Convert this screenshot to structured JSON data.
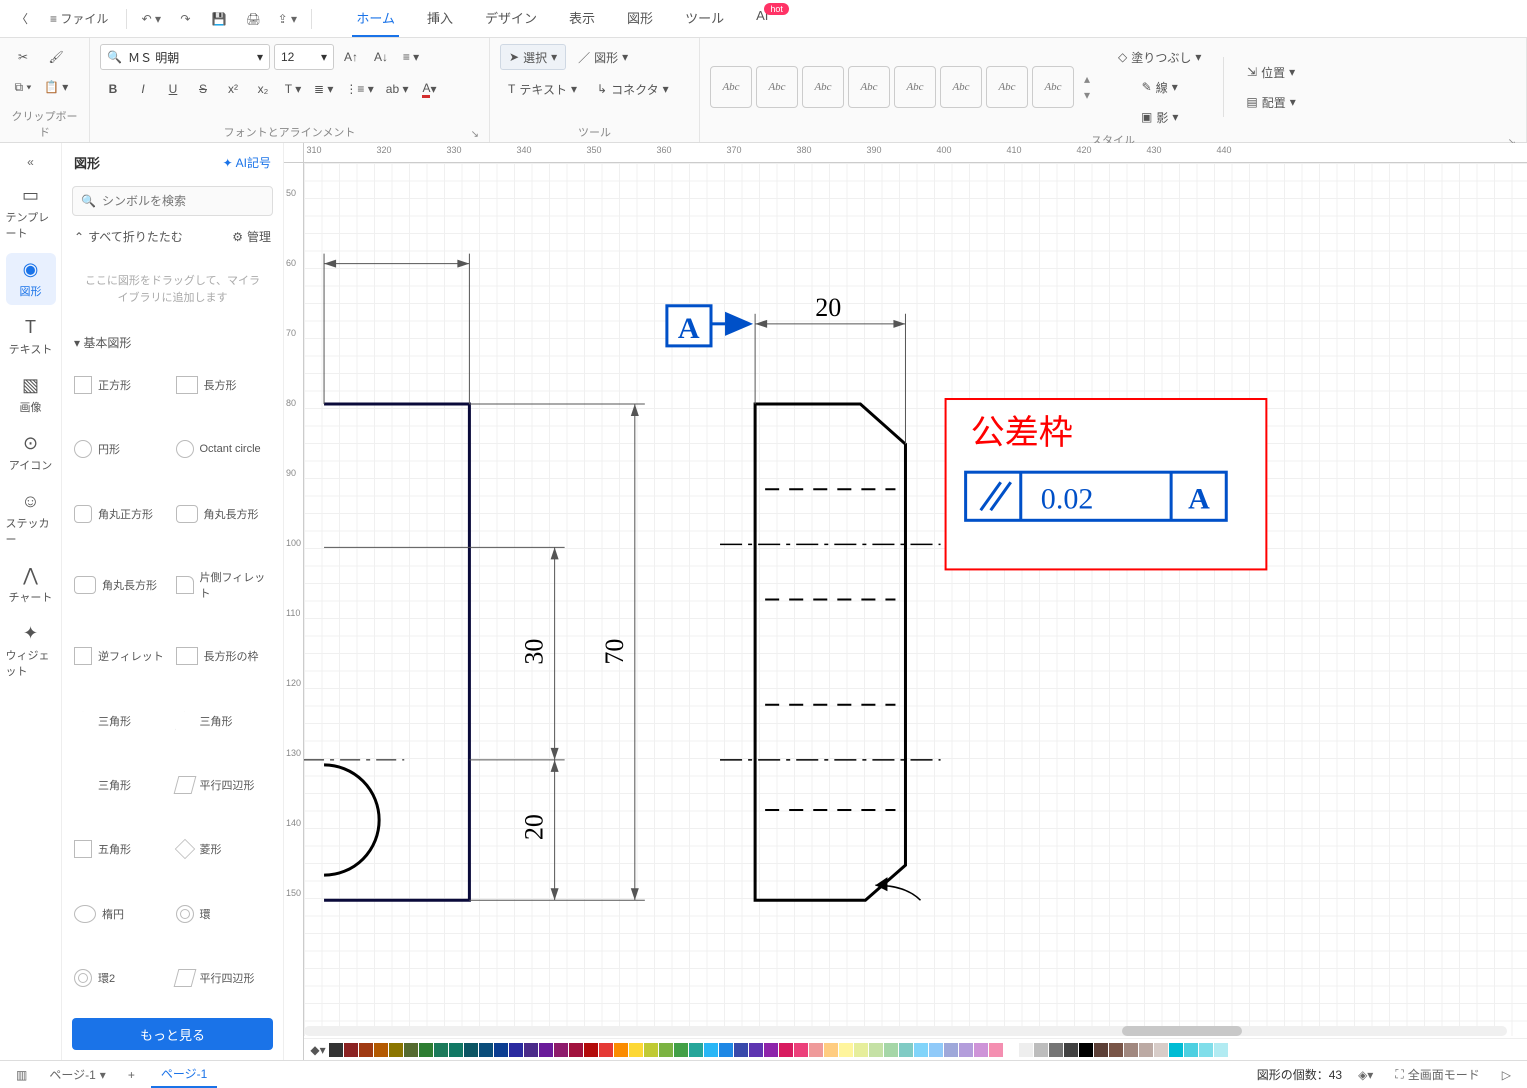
{
  "menubar": {
    "file": "ファイル",
    "tabs": [
      "ホーム",
      "挿入",
      "デザイン",
      "表示",
      "図形",
      "ツール",
      "AI"
    ],
    "active_tab": 0,
    "ai_badge": "hot"
  },
  "ribbon": {
    "clipboard_label": "クリップボード",
    "font_label": "フォントとアラインメント",
    "tool_label": "ツール",
    "style_label": "スタイル",
    "font_name": "ＭＳ 明朝",
    "font_size": "12",
    "select": "選択",
    "shape_menu": "図形",
    "text": "テキスト",
    "connector": "コネクタ",
    "style_item": "Abc",
    "fill": "塗りつぶし",
    "line": "線",
    "shadow": "影",
    "position": "位置",
    "align": "配置"
  },
  "leftrail": {
    "items": [
      {
        "label": "テンプレート",
        "icon": "▭"
      },
      {
        "label": "図形",
        "icon": "◉"
      },
      {
        "label": "テキスト",
        "icon": "T"
      },
      {
        "label": "画像",
        "icon": "▧"
      },
      {
        "label": "アイコン",
        "icon": "⊙"
      },
      {
        "label": "ステッカー",
        "icon": "☺"
      },
      {
        "label": "チャート",
        "icon": "⋀"
      },
      {
        "label": "ウィジェット",
        "icon": "✦"
      }
    ],
    "active": 1
  },
  "shapes_panel": {
    "title": "図形",
    "ai_link": "AI記号",
    "search_placeholder": "シンボルを検索",
    "collapse_all": "すべて折りたたむ",
    "manage": "管理",
    "drop_hint": "ここに図形をドラッグして、マイライブラリに追加します",
    "section": "基本図形",
    "shapes": [
      "正方形",
      "長方形",
      "円形",
      "Octant circle",
      "角丸正方形",
      "角丸長方形",
      "角丸長方形",
      "片側フィレット",
      "逆フィレット",
      "長方形の枠",
      "三角形",
      "三角形",
      "三角形",
      "平行四辺形",
      "五角形",
      "菱形",
      "楕円",
      "環",
      "環2",
      "平行四辺形"
    ],
    "more": "もっと見る"
  },
  "ruler_h_start": 310,
  "ruler_h_step": 10,
  "ruler_h_count": 94,
  "ruler_v_start": 50,
  "ruler_v_step": 10,
  "ruler_v_count": 11,
  "drawing": {
    "datum_label": "A",
    "dim_20": "20",
    "dim_70": "70",
    "dim_30": "30",
    "dim_20b": "20",
    "callout_title": "公差枠",
    "tol_value": "0.02",
    "tol_datum": "A"
  },
  "colors": [
    "#333333",
    "#8b2222",
    "#a03a12",
    "#b35900",
    "#8b7500",
    "#556b2f",
    "#2e7d32",
    "#1b7a5a",
    "#117864",
    "#0b5563",
    "#0a4d7a",
    "#0b3d91",
    "#2a2aa0",
    "#4b2a8a",
    "#6a1b9a",
    "#8e1b6b",
    "#a1123e",
    "#b30b0b",
    "#e53935",
    "#fb8c00",
    "#fdd835",
    "#c0ca33",
    "#7cb342",
    "#43a047",
    "#26a69a",
    "#29b6f6",
    "#1e88e5",
    "#3949ab",
    "#5e35b1",
    "#8e24aa",
    "#d81b60",
    "#ec407a",
    "#ef9a9a",
    "#ffcc80",
    "#fff59d",
    "#e6ee9c",
    "#c5e1a5",
    "#a5d6a7",
    "#80cbc4",
    "#81d4fa",
    "#90caf9",
    "#9fa8da",
    "#b39ddb",
    "#ce93d8",
    "#f48fb1",
    "#ffffff",
    "#eeeeee",
    "#bdbdbd",
    "#757575",
    "#424242",
    "#000000",
    "#5d4037",
    "#795548",
    "#a1887f",
    "#bcaaa4",
    "#d7ccc8",
    "#00bcd4",
    "#4dd0e1",
    "#80deea",
    "#b2ebf2"
  ],
  "statusbar": {
    "page_label": "ページ-1",
    "page_tab": "ページ-1",
    "add_page": "+",
    "shape_count_label": "図形の個数：",
    "shape_count": "43",
    "fullscreen": "全画面モード"
  }
}
